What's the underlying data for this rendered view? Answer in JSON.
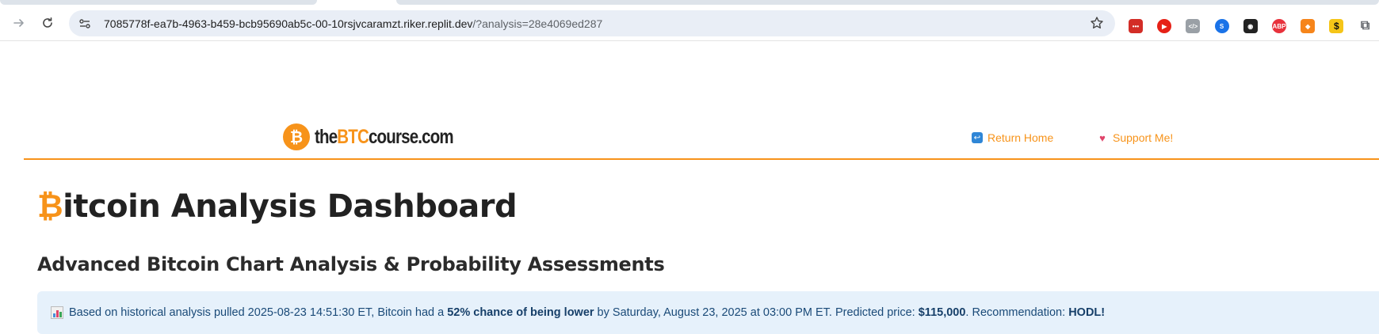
{
  "browser": {
    "url_host": "7085778f-ea7b-4963-b459-bcb95690ab5c-00-10rsjvcaramzt.riker.replit.dev",
    "url_path": "/?analysis=28e4069ed287",
    "extensions": [
      {
        "name": "lastpass-icon",
        "color": "#d32d27",
        "glyph": "•••"
      },
      {
        "name": "youtube-icon",
        "color": "#e62117",
        "glyph": "▶"
      },
      {
        "name": "code-icon",
        "color": "#9aa0a6",
        "glyph": "</>"
      },
      {
        "name": "sync-icon",
        "color": "#1a73e8",
        "glyph": "S"
      },
      {
        "name": "tampermonkey-icon",
        "color": "#222222",
        "glyph": "◉"
      },
      {
        "name": "adblock-plus-icon",
        "color": "#e8323c",
        "glyph": "ABP"
      },
      {
        "name": "metamask-icon",
        "color": "#f6851b",
        "glyph": "◆"
      },
      {
        "name": "dollar-icon",
        "color": "#f5c518",
        "glyph": "$"
      },
      {
        "name": "puzzle-icon",
        "color": "#5f6368",
        "glyph": "⧉"
      }
    ]
  },
  "header": {
    "logo": {
      "prefix": "the",
      "highlight": "BTC",
      "suffix": "course.com",
      "coin_glyph": "₿"
    },
    "nav": {
      "home_icon": "↩",
      "home_label": "Return Home",
      "support_icon": "♥",
      "support_label": "Support Me!"
    }
  },
  "main": {
    "title_symbol": "₿",
    "title_rest": "itcoin Analysis Dashboard",
    "subtitle": "Advanced Bitcoin Chart Analysis & Probability Assessments",
    "alert": {
      "text_1": "Based on historical analysis pulled 2025-08-23 14:51:30 ET, Bitcoin had a ",
      "bold_1": "52% chance of being lower",
      "text_2": " by Saturday, August 23, 2025 at 03:00 PM ET. Predicted price: ",
      "bold_2": "$115,000",
      "text_3": ". Recommendation: ",
      "bold_3": "HODL!"
    }
  },
  "colors": {
    "accent": "#f7931a",
    "alert_bg": "#e6f1fb",
    "alert_text": "#1a4a78"
  }
}
